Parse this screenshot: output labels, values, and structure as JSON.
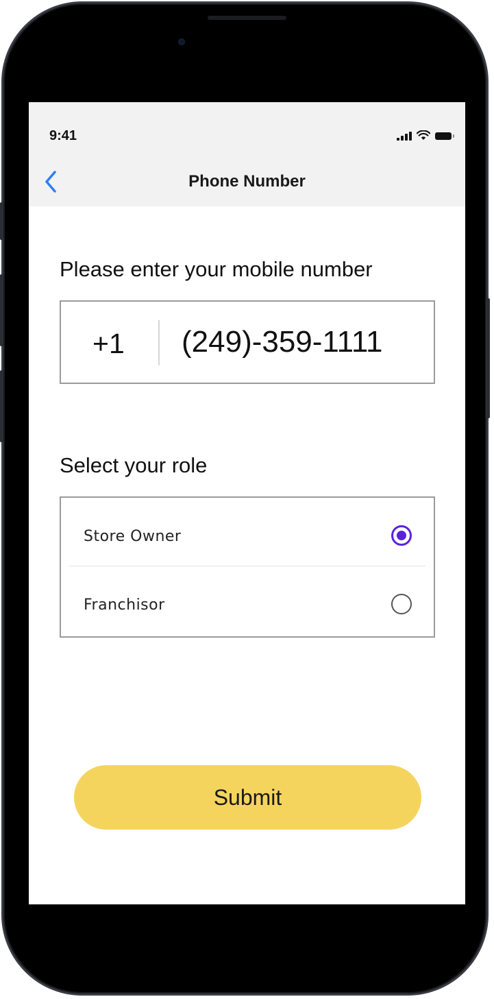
{
  "status_bar": {
    "time": "9:41",
    "icons": [
      "signal-icon",
      "wifi-icon",
      "battery-icon"
    ]
  },
  "nav": {
    "back_icon": "chevron-left-icon",
    "title": "Phone Number"
  },
  "phone_section": {
    "label": "Please enter your mobile number",
    "country_code": "+1",
    "phone_value": "(249)-359-1111"
  },
  "role_section": {
    "label": "Select your role",
    "options": [
      {
        "label": "Store Owner",
        "selected": true
      },
      {
        "label": "Franchisor",
        "selected": false
      }
    ]
  },
  "submit": {
    "label": "Submit"
  },
  "colors": {
    "accent": "#5b21e0",
    "button": "#f5d45e",
    "back_icon": "#2f7df6",
    "header_bg": "#f2f2f2"
  }
}
